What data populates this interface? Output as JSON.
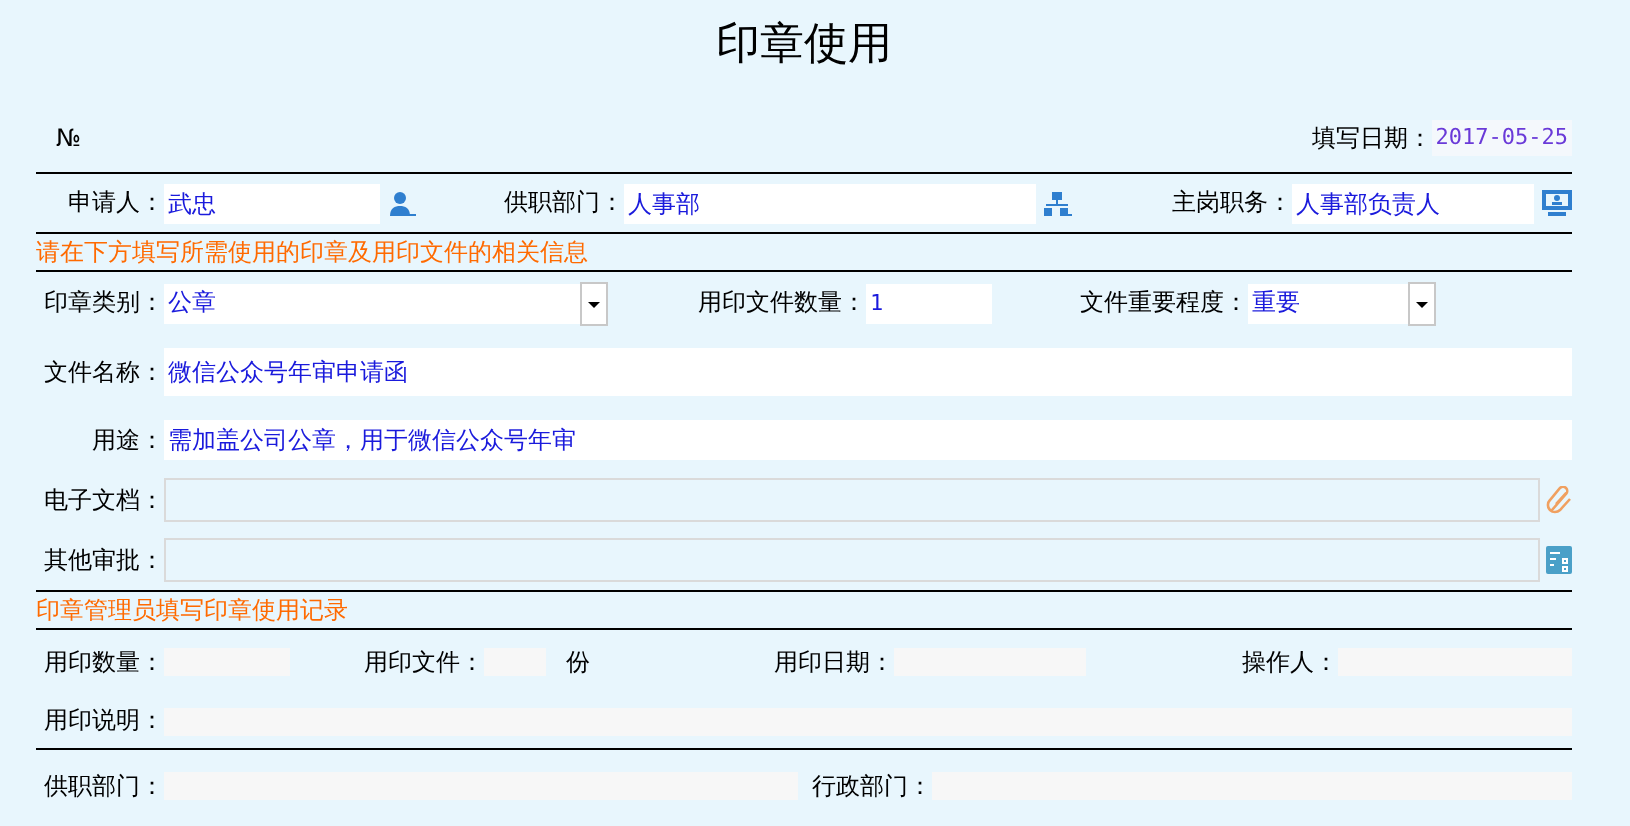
{
  "title": "印章使用",
  "number_mark": "№",
  "fill_date": {
    "label": "填写日期：",
    "value": "2017-05-25"
  },
  "applicant": {
    "label": "申请人：",
    "value": "武忠"
  },
  "department": {
    "label": "供职部门：",
    "value": "人事部"
  },
  "position": {
    "label": "主岗职务：",
    "value": "人事部负责人"
  },
  "section_request": "请在下方填写所需使用的印章及用印文件的相关信息",
  "seal_type": {
    "label": "印章类别：",
    "value": "公章"
  },
  "doc_count": {
    "label": "用印文件数量：",
    "value": "1"
  },
  "importance": {
    "label": "文件重要程度：",
    "value": "重要"
  },
  "doc_name": {
    "label": "文件名称：",
    "value": "微信公众号年审申请函"
  },
  "purpose": {
    "label": "用途：",
    "value": "需加盖公司公章，用于微信公众号年审"
  },
  "e_document": {
    "label": "电子文档：",
    "disabled": true
  },
  "other_approval": {
    "label": "其他审批：",
    "disabled": true
  },
  "section_record": "印章管理员填写印章使用记录",
  "record": {
    "count_label": "用印数量：",
    "file_label": "用印文件：",
    "copies_unit": "份",
    "date_label": "用印日期：",
    "operator_label": "操作人：",
    "note_label": "用印说明："
  },
  "departments": {
    "dept_label": "供职部门：",
    "admin_label": "行政部门："
  }
}
